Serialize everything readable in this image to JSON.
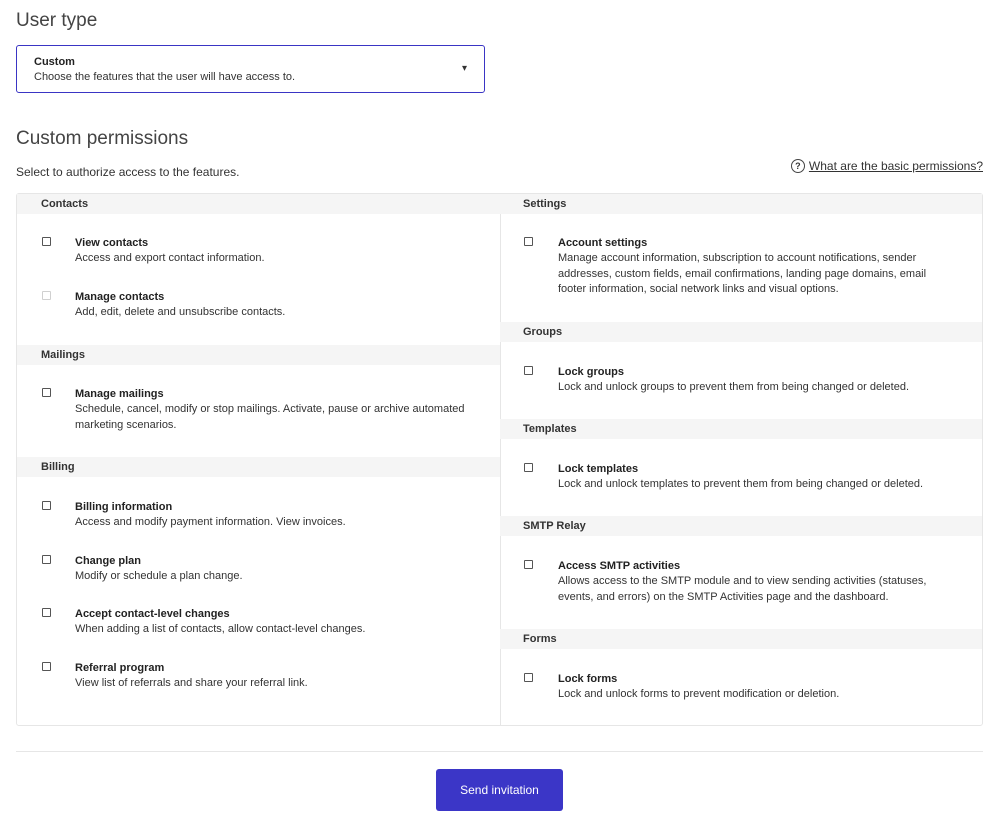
{
  "user_type": {
    "title": "User type",
    "selected": "Custom",
    "selected_desc": "Choose the features that the user will have access to.",
    "arrow": "▾"
  },
  "custom_permissions": {
    "title": "Custom permissions",
    "intro": "Select to authorize access to the features.",
    "help_link": "What are the basic permissions?"
  },
  "left_sections": [
    {
      "header": "Contacts",
      "items": [
        {
          "title": "View contacts",
          "desc": "Access and export contact information.",
          "checked": false,
          "disabled": false
        },
        {
          "title": "Manage contacts",
          "desc": "Add, edit, delete and unsubscribe contacts.",
          "checked": false,
          "disabled": true
        }
      ]
    },
    {
      "header": "Mailings",
      "items": [
        {
          "title": "Manage mailings",
          "desc": "Schedule, cancel, modify or stop mailings. Activate, pause or archive automated marketing scenarios.",
          "checked": false,
          "disabled": false
        }
      ]
    },
    {
      "header": "Billing",
      "items": [
        {
          "title": "Billing information",
          "desc": "Access and modify payment information. View invoices.",
          "checked": false,
          "disabled": false
        },
        {
          "title": "Change plan",
          "desc": "Modify or schedule a plan change.",
          "checked": false,
          "disabled": false
        },
        {
          "title": "Accept contact-level changes",
          "desc": "When adding a list of contacts, allow contact-level changes.",
          "checked": false,
          "disabled": false
        },
        {
          "title": "Referral program",
          "desc": "View list of referrals and share your referral link.",
          "checked": false,
          "disabled": false
        }
      ]
    }
  ],
  "right_sections": [
    {
      "header": "Settings",
      "items": [
        {
          "title": "Account settings",
          "desc": "Manage account information, subscription to account notifications, sender addresses, custom fields, email confirmations, landing page domains, email footer information, social network links and visual options.",
          "checked": false,
          "disabled": false
        }
      ]
    },
    {
      "header": "Groups",
      "items": [
        {
          "title": "Lock groups",
          "desc": "Lock and unlock groups to prevent them from being changed or deleted.",
          "checked": false,
          "disabled": false
        }
      ]
    },
    {
      "header": "Templates",
      "items": [
        {
          "title": "Lock templates",
          "desc": "Lock and unlock templates to prevent them from being changed or deleted.",
          "checked": false,
          "disabled": false
        }
      ]
    },
    {
      "header": "SMTP Relay",
      "items": [
        {
          "title": "Access SMTP activities",
          "desc": "Allows access to the SMTP module and to view sending activities (statuses, events, and errors) on the SMTP Activities page and the dashboard.",
          "checked": false,
          "disabled": false
        }
      ]
    },
    {
      "header": "Forms",
      "items": [
        {
          "title": "Lock forms",
          "desc": "Lock and unlock forms to prevent modification or deletion.",
          "checked": false,
          "disabled": false
        }
      ]
    }
  ],
  "send_button": "Send invitation",
  "colors": {
    "accent": "#3b36c7",
    "select_border": "#3a35c4"
  }
}
